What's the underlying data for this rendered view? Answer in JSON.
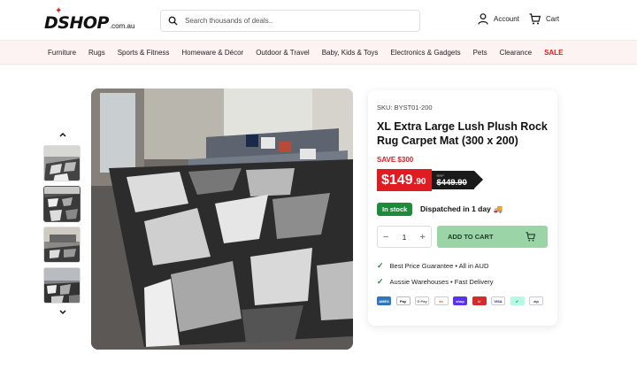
{
  "header": {
    "logo_text": "DSHOP",
    "logo_suffix": ".com.au",
    "search_placeholder": "Search thousands of deals..",
    "account_label": "Account",
    "cart_label": "Cart"
  },
  "nav": {
    "items": [
      "Furniture",
      "Rugs",
      "Sports & Fitness",
      "Homeware & Décor",
      "Outdoor & Travel",
      "Baby, Kids & Toys",
      "Electronics & Gadgets",
      "Pets",
      "Clearance"
    ],
    "sale_label": "SALE"
  },
  "product": {
    "sku": "SKU: BYST01-200",
    "title": "XL Extra Large Lush Plush Rock Rug Carpet Mat (300 x 200)",
    "save": "SAVE $300",
    "price_dollars": "$149",
    "price_cents": ".90",
    "rrp_label": "RRP",
    "was_price": "$449.90",
    "stock": "In stock",
    "dispatch": "Dispatched in 1 day",
    "quantity": "1",
    "add_to_cart": "ADD TO CART",
    "features": [
      "Best Price Guarantee • All in AUD",
      "Aussie Warehouses • Fast Delivery"
    ],
    "payments": [
      {
        "label": "AMEX",
        "bg": "#2e77bc",
        "fg": "#ffffff"
      },
      {
        "label": "Pay",
        "bg": "#ffffff",
        "fg": "#111111"
      },
      {
        "label": "G Pay",
        "bg": "#ffffff",
        "fg": "#555555"
      },
      {
        "label": "●●",
        "bg": "#ffffff",
        "fg": "#eb5a1e"
      },
      {
        "label": "shop",
        "bg": "#5a31f4",
        "fg": "#ffffff"
      },
      {
        "label": "U",
        "bg": "#d62b2b",
        "fg": "#ffffff"
      },
      {
        "label": "VISA",
        "bg": "#ffffff",
        "fg": "#1a1f71"
      },
      {
        "label": "✓",
        "bg": "#b2fce4",
        "fg": "#111111"
      },
      {
        "label": "zip",
        "bg": "#ffffff",
        "fg": "#411361"
      }
    ]
  },
  "colors": {
    "brand_red": "#e11b22",
    "stock_green": "#1f8a3b",
    "cart_button": "#9ad4a7",
    "nav_bg": "#fdf3f3"
  }
}
